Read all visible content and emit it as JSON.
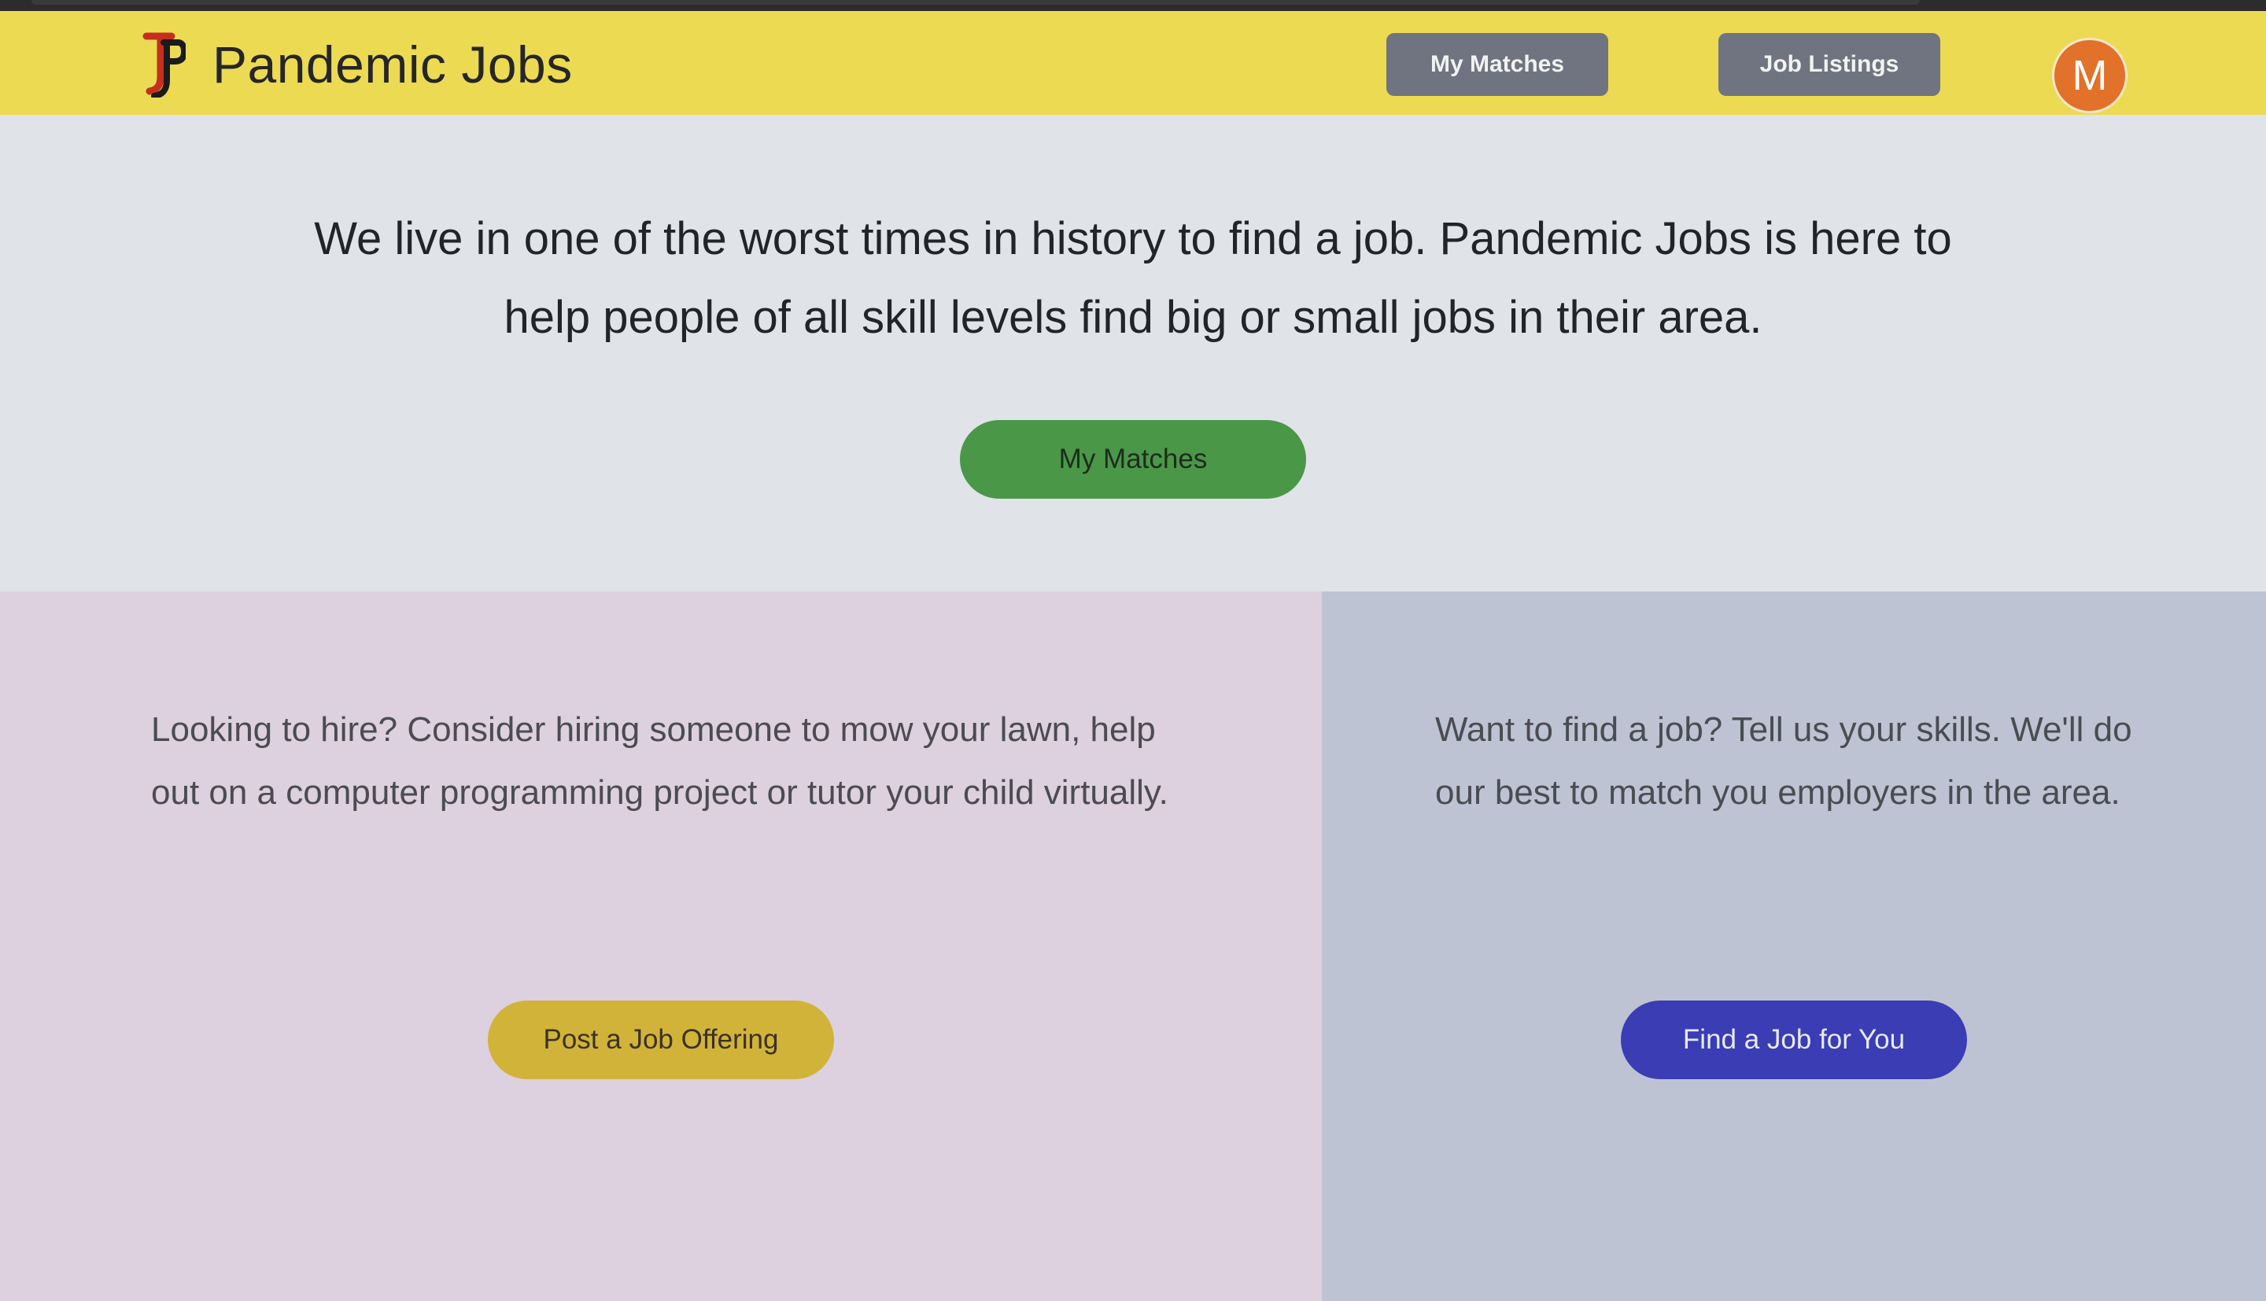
{
  "header": {
    "logo_text": "JP",
    "brand_name": "Pandemic Jobs",
    "nav": {
      "my_matches": "My Matches",
      "job_listings": "Job Listings"
    },
    "avatar_initial": "M"
  },
  "hero": {
    "text": "We live in one of the worst times in history to find a job. Pandemic Jobs is here to help people of all skill levels find big or small jobs in their area.",
    "button": "My Matches"
  },
  "hire_panel": {
    "text": "Looking to hire? Consider hiring someone to mow your lawn, help out on a computer programming project or tutor your child virtually.",
    "button": "Post a Job Offering"
  },
  "seek_panel": {
    "text": "Want to find a job? Tell us your skills. We'll do our best to match you employers in the area.",
    "button": "Find a Job for You"
  },
  "colors": {
    "navbar": "#ecda52",
    "nav_button": "#6f7480",
    "avatar": "#e2712a",
    "hero_bg": "#e0e3e8",
    "hero_button": "#4a9748",
    "hire_bg": "#ddd0df",
    "hire_button": "#d1b33a",
    "seek_bg": "#bec3d3",
    "seek_button": "#3a3db4"
  }
}
